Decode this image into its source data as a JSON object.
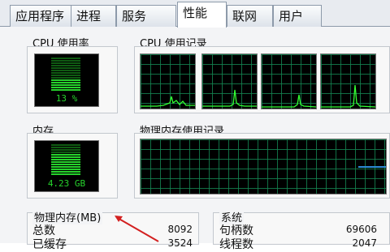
{
  "tabs": [
    "应用程序",
    "进程",
    "服务",
    "性能",
    "联网",
    "用户"
  ],
  "active_tab": "性能",
  "cpu_usage": {
    "label": "CPU 使用率",
    "value": "13 %"
  },
  "cpu_history": {
    "label": "CPU 使用记录"
  },
  "memory": {
    "label": "内存",
    "value": "4.23 GB"
  },
  "physical_memory_history": {
    "label": "物理内存使用记录"
  },
  "physical_memory": {
    "label": "物理内存(MB)",
    "rows": [
      {
        "name": "总数",
        "value": "8092"
      },
      {
        "name": "已缓存",
        "value": "3524"
      }
    ]
  },
  "system": {
    "label": "系统",
    "rows": [
      {
        "name": "句柄数",
        "value": "69606"
      },
      {
        "name": "线程数",
        "value": "2047"
      }
    ]
  },
  "colors": {
    "meter_green": "#26d22c",
    "grid_green": "#148250",
    "trace_green": "#33ff33",
    "mem_line_blue": "#2d8dd6",
    "annotation_red": "#d32020"
  }
}
